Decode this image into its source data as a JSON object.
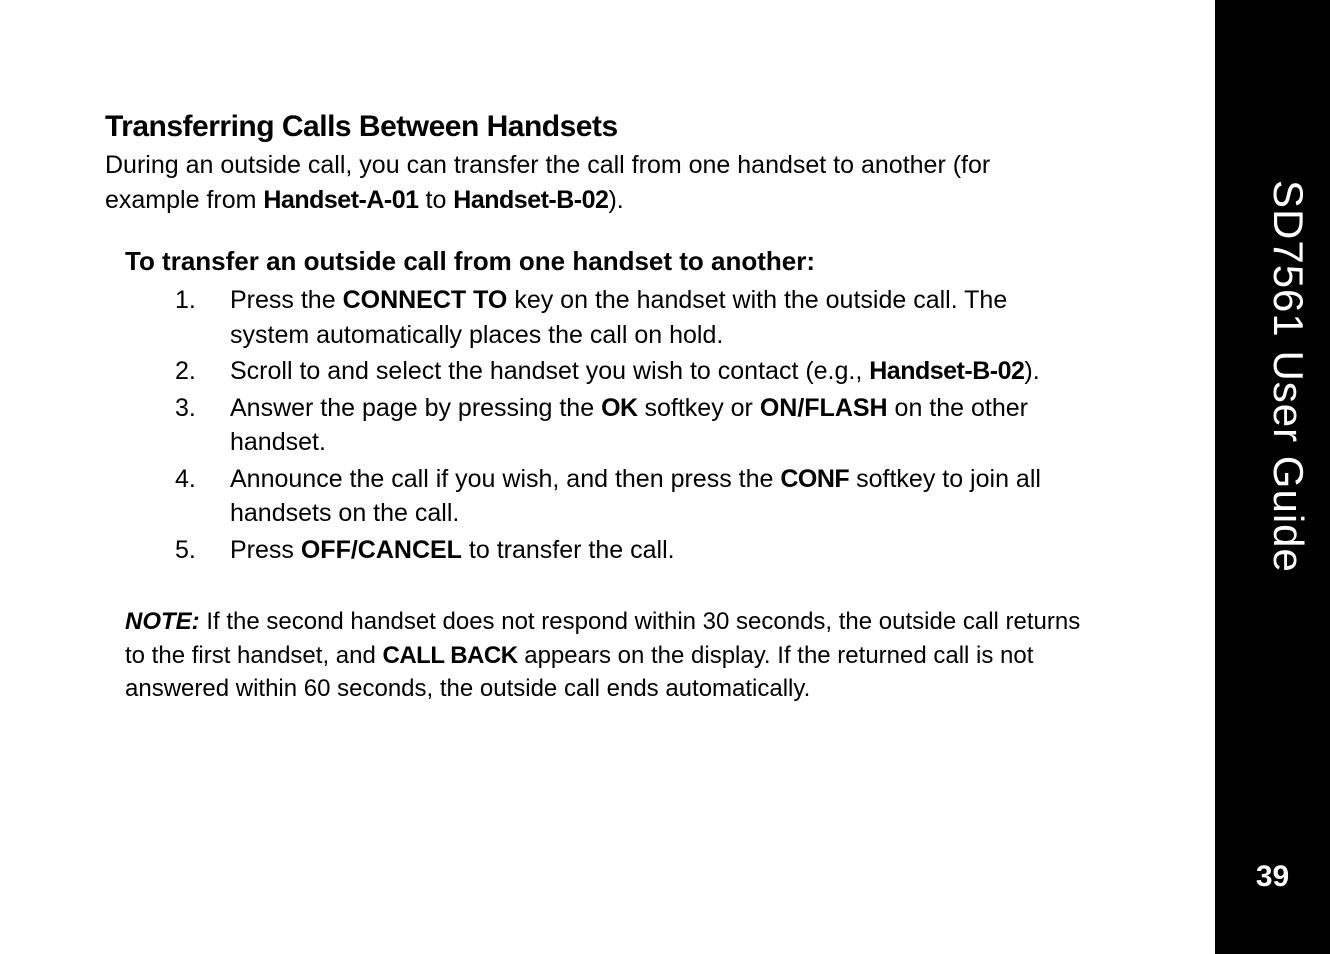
{
  "sidebar": {
    "guide_title": "SD7561 User Guide",
    "page_number": "39"
  },
  "section": {
    "title": "Transferring Calls Between Handsets",
    "intro_before_hs_a": "During an outside call, you can transfer the call from one handset to another (for example from ",
    "handset_a": "Handset-A-01",
    "intro_between": " to ",
    "handset_b": "Handset-B-02",
    "intro_after": ").",
    "sub_heading": "To transfer an outside call from one handset to another:",
    "steps": [
      {
        "num": "1.",
        "parts": [
          {
            "t": "Press the "
          },
          {
            "t": "CONNECT TO",
            "cls": "bold"
          },
          {
            "t": " key on the handset with the outside call. The system automatically places the call on hold."
          }
        ]
      },
      {
        "num": "2.",
        "parts": [
          {
            "t": "Scroll to and select the handset you wish to contact (e.g., "
          },
          {
            "t": "Handset-B-02",
            "cls": "lcd"
          },
          {
            "t": ")."
          }
        ]
      },
      {
        "num": "3.",
        "parts": [
          {
            "t": "Answer the page by pressing the "
          },
          {
            "t": "OK",
            "cls": "lcd"
          },
          {
            "t": " softkey or "
          },
          {
            "t": "ON/FLASH",
            "cls": "bold"
          },
          {
            "t": " on the other handset."
          }
        ]
      },
      {
        "num": "4.",
        "parts": [
          {
            "t": "Announce the call if you wish, and then press the "
          },
          {
            "t": "CONF",
            "cls": "lcd"
          },
          {
            "t": " softkey to join all handsets on the call."
          }
        ]
      },
      {
        "num": "5.",
        "parts": [
          {
            "t": "Press "
          },
          {
            "t": "OFF/CANCEL",
            "cls": "bold"
          },
          {
            "t": " to transfer the call."
          }
        ]
      }
    ],
    "note_label": "NOTE:",
    "note_parts": [
      {
        "t": "  If the second handset does not respond within 30 seconds, the outside call returns to the first handset, and "
      },
      {
        "t": "CALL BACK",
        "cls": "lcd"
      },
      {
        "t": " appears on the display. If the returned call is not answered within 60 seconds, the outside call ends automatically."
      }
    ]
  }
}
